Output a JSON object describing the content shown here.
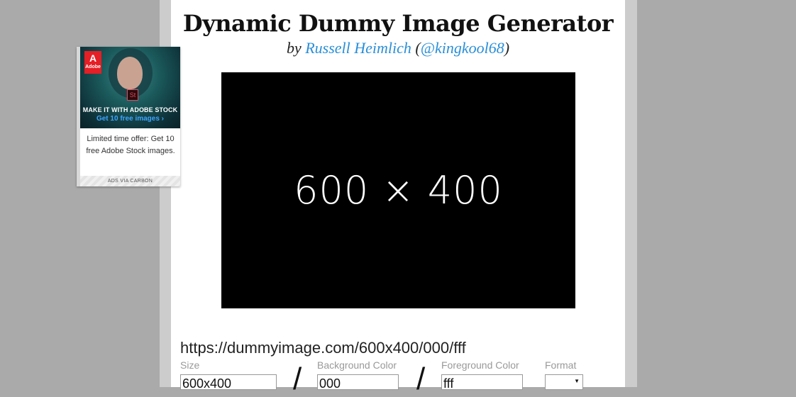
{
  "header": {
    "title": "Dynamic Dummy Image Generator",
    "by": "by",
    "author": "Russell Heimlich",
    "paren_open": "(",
    "handle": "@kingkool68",
    "paren_close": ")"
  },
  "preview": {
    "text": "600 × 400",
    "background": "#000000",
    "foreground": "#ffffff"
  },
  "url": "https://dummyimage.com/600x400/000/fff",
  "form": {
    "size_label": "Size",
    "size_value": "600x400",
    "bg_label": "Background Color",
    "bg_value": "000",
    "fg_label": "Foreground Color",
    "fg_value": "fff",
    "format_label": "Format",
    "separator": "/"
  },
  "ad": {
    "logo": "Adobe",
    "badge": "St",
    "headline": "MAKE IT WITH ADOBE STOCK",
    "cta": "Get 10 free images ›",
    "body": "Limited time offer: Get 10 free Adobe Stock images.",
    "footer": "ADS VIA CARBON"
  },
  "colors": {
    "link": "#2a8fd8",
    "page_bg": "#aaaaaa",
    "frame": "#cccccc"
  }
}
